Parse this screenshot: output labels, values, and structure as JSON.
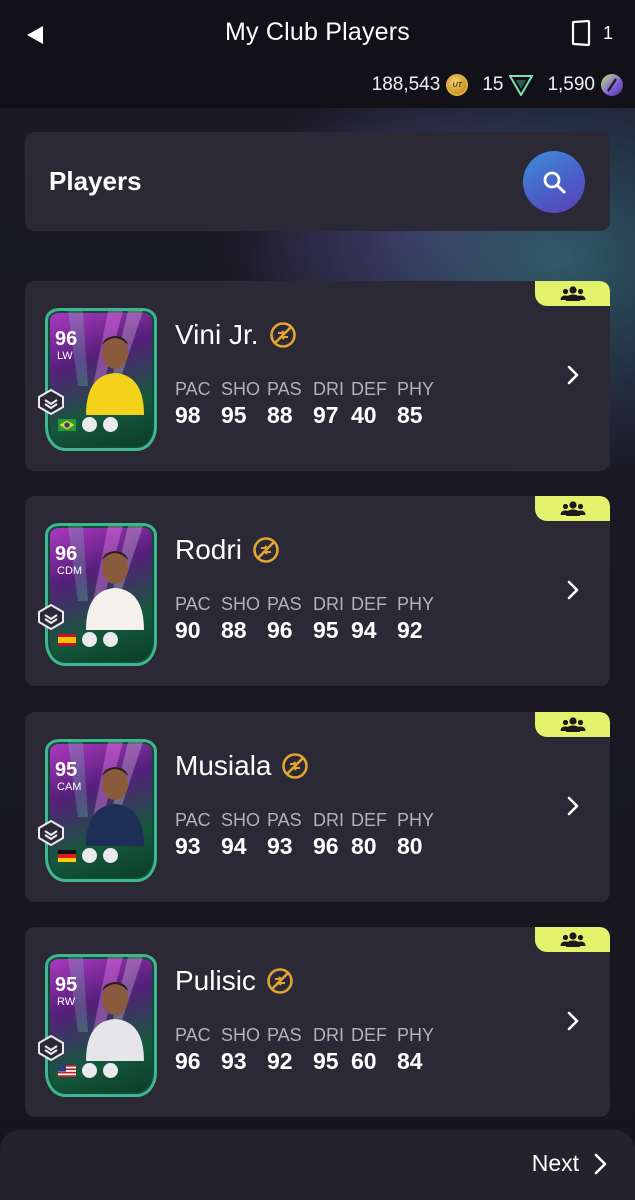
{
  "header": {
    "title": "My Club Players",
    "squad_count": "1"
  },
  "currencies": {
    "coins": "188,543",
    "points": "15",
    "gems": "1,590"
  },
  "search": {
    "label": "Players"
  },
  "players": [
    {
      "name": "Vini Jr.",
      "rating": "96",
      "position": "LW",
      "stats_labels": [
        "PAC",
        "SHO",
        "PAS",
        "DRI",
        "DEF",
        "PHY"
      ],
      "stats": [
        "98",
        "95",
        "88",
        "97",
        "40",
        "85"
      ],
      "kit_color": "#f2d21b",
      "flag": "brazil"
    },
    {
      "name": "Rodri",
      "rating": "96",
      "position": "CDM",
      "stats_labels": [
        "PAC",
        "SHO",
        "PAS",
        "DRI",
        "DEF",
        "PHY"
      ],
      "stats": [
        "90",
        "88",
        "96",
        "95",
        "94",
        "92"
      ],
      "kit_color": "#f4f1ec",
      "flag": "spain"
    },
    {
      "name": "Musiala",
      "rating": "95",
      "position": "CAM",
      "stats_labels": [
        "PAC",
        "SHO",
        "PAS",
        "DRI",
        "DEF",
        "PHY"
      ],
      "stats": [
        "93",
        "94",
        "93",
        "96",
        "80",
        "80"
      ],
      "kit_color": "#1d2f55",
      "flag": "germany"
    },
    {
      "name": "Pulisic",
      "rating": "95",
      "position": "RW",
      "stats_labels": [
        "PAC",
        "SHO",
        "PAS",
        "DRI",
        "DEF",
        "PHY"
      ],
      "stats": [
        "96",
        "93",
        "92",
        "95",
        "60",
        "84"
      ],
      "kit_color": "#e6e6ea",
      "flag": "usa"
    }
  ],
  "footer": {
    "next_label": "Next"
  },
  "colors": {
    "accent_tag": "#e3f26c",
    "card_bg": "#2a2935",
    "untradeable": "#e2a630"
  },
  "icons": [
    "back-arrow-icon",
    "squad-slot-icon",
    "coin-icon",
    "points-icon",
    "gem-icon",
    "search-icon",
    "group-icon",
    "untradeable-icon",
    "chevron-right-icon"
  ]
}
